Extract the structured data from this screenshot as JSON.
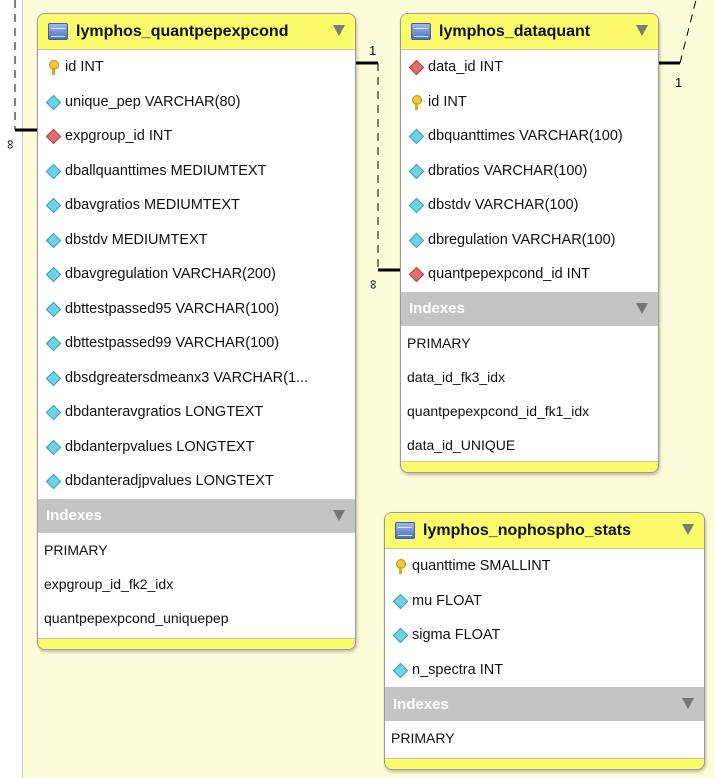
{
  "tables": {
    "quantpepexpcond": {
      "title": "lymphos_quantpepexpcond",
      "columns": [
        {
          "icon": "primary-key-icon",
          "text": "id INT"
        },
        {
          "icon": "column-icon",
          "text": "unique_pep VARCHAR(80)"
        },
        {
          "icon": "foreign-key-icon",
          "text": "expgroup_id INT"
        },
        {
          "icon": "column-icon",
          "text": "dballquanttimes MEDIUMTEXT"
        },
        {
          "icon": "column-icon",
          "text": "dbavgratios MEDIUMTEXT"
        },
        {
          "icon": "column-icon",
          "text": "dbstdv MEDIUMTEXT"
        },
        {
          "icon": "column-icon",
          "text": "dbavgregulation VARCHAR(200)"
        },
        {
          "icon": "column-icon",
          "text": "dbttestpassed95 VARCHAR(100)"
        },
        {
          "icon": "column-icon",
          "text": "dbttestpassed99 VARCHAR(100)"
        },
        {
          "icon": "column-icon",
          "text": "dbsdgreatersdmeanx3 VARCHAR(1..."
        },
        {
          "icon": "column-icon",
          "text": "dbdanteravgratios LONGTEXT"
        },
        {
          "icon": "column-icon",
          "text": "dbdanterpvalues LONGTEXT"
        },
        {
          "icon": "column-icon",
          "text": "dbdanteradjpvalues LONGTEXT"
        }
      ],
      "indexes_label": "Indexes",
      "indexes": [
        "PRIMARY",
        "expgroup_id_fk2_idx",
        "quantpepexpcond_uniquepep"
      ]
    },
    "dataquant": {
      "title": "lymphos_dataquant",
      "columns": [
        {
          "icon": "foreign-key-icon",
          "text": "data_id INT"
        },
        {
          "icon": "primary-key-icon",
          "text": "id INT"
        },
        {
          "icon": "column-icon",
          "text": "dbquanttimes VARCHAR(100)"
        },
        {
          "icon": "column-icon",
          "text": "dbratios VARCHAR(100)"
        },
        {
          "icon": "column-icon",
          "text": "dbstdv VARCHAR(100)"
        },
        {
          "icon": "column-icon",
          "text": "dbregulation VARCHAR(100)"
        },
        {
          "icon": "foreign-key-icon",
          "text": "quantpepexpcond_id INT"
        }
      ],
      "indexes_label": "Indexes",
      "indexes": [
        "PRIMARY",
        "data_id_fk3_idx",
        "quantpepexpcond_id_fk1_idx",
        "data_id_UNIQUE"
      ]
    },
    "nophospho_stats": {
      "title": "lymphos_nophospho_stats",
      "columns": [
        {
          "icon": "primary-key-icon",
          "text": "quanttime SMALLINT"
        },
        {
          "icon": "column-icon",
          "text": "mu FLOAT"
        },
        {
          "icon": "column-icon",
          "text": "sigma FLOAT"
        },
        {
          "icon": "column-icon",
          "text": "n_spectra INT"
        }
      ],
      "indexes_label": "Indexes",
      "indexes": [
        "PRIMARY"
      ]
    }
  },
  "relations": {
    "left_many": "∞",
    "mid_one": "1",
    "mid_many": "∞",
    "right_one": "1"
  },
  "colors": {
    "canvas": "#fdfcd9",
    "header": "#fbfb6b",
    "index_header": "#c4c4c4"
  }
}
